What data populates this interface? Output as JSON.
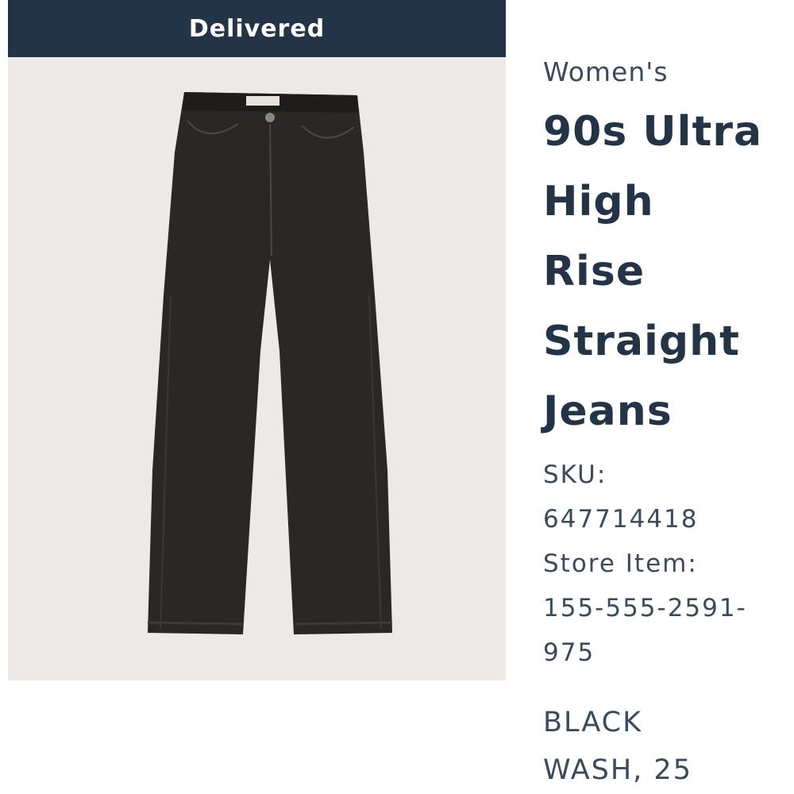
{
  "status": {
    "label": "Delivered"
  },
  "product": {
    "category": "Women's",
    "name_lines": [
      "90s Ultra",
      "High",
      "Rise",
      "Straight",
      "Jeans"
    ],
    "sku_label": "SKU:",
    "sku_value": "647714418",
    "store_item_label": "Store Item:",
    "store_item_lines": [
      "155-555-2591-",
      "975"
    ],
    "variant_lines": [
      "BLACK",
      "WASH, 25"
    ]
  },
  "image": {
    "icon": "jeans-product-photo"
  },
  "colors": {
    "banner": "#233447",
    "text": "#233447",
    "image_background": "#ece9e7",
    "denim": "#2a2826"
  }
}
